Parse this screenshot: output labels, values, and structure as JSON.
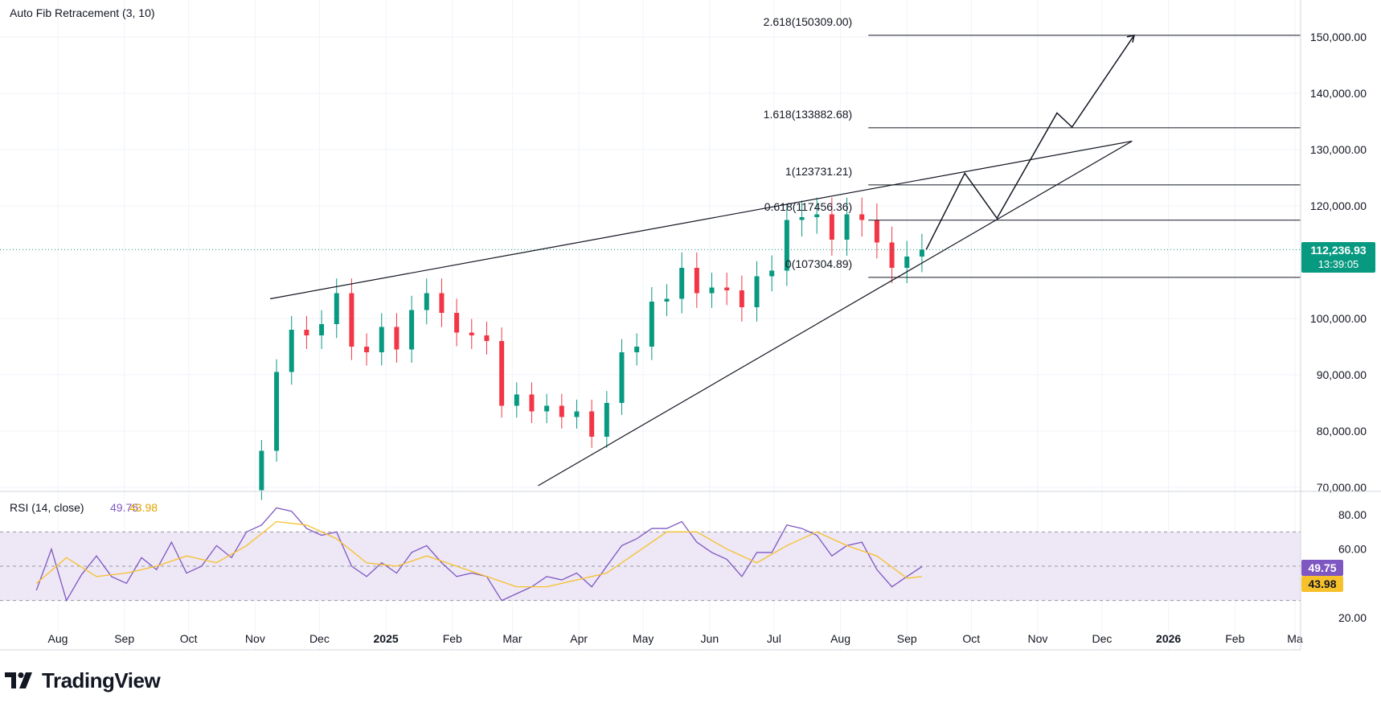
{
  "brand": {
    "name": "TradingView",
    "icon": "tradingview-logo"
  },
  "colors": {
    "bull": "#089981",
    "bear": "#F23645",
    "rsi": "#7E57C2",
    "rsi_ma": "#F7C12B",
    "rsi_band": "#EDE7F6",
    "price_badge": "#089981",
    "grid": "#F0F3FA",
    "lines": "#131722"
  },
  "chart_data": [
    {
      "type": "candlestick",
      "title": "Auto Fib Retracement (3, 10)",
      "ylim": [
        68000,
        155000
      ],
      "y_ticks": [
        "150,000.00",
        "140,000.00",
        "130,000.00",
        "120,000.00",
        "100,000.00",
        "90,000.00",
        "80,000.00",
        "70,000.00"
      ],
      "y_tick_values": [
        150000,
        140000,
        130000,
        120000,
        100000,
        90000,
        80000,
        70000
      ],
      "x_ticks": [
        "Aug",
        "Sep",
        "Oct",
        "Nov",
        "Dec",
        "2025",
        "Feb",
        "Mar",
        "Apr",
        "May",
        "Jun",
        "Jul",
        "Aug",
        "Sep",
        "Oct",
        "Nov",
        "Dec",
        "2026",
        "Feb",
        "Ma"
      ],
      "x_tick_dates": [
        "2024-08-01",
        "2024-09-01",
        "2024-10-01",
        "2024-11-01",
        "2024-12-01",
        "2025-01-01",
        "2025-02-01",
        "2025-03-01",
        "2025-04-01",
        "2025-05-01",
        "2025-06-01",
        "2025-07-01",
        "2025-08-01",
        "2025-09-01",
        "2025-10-01",
        "2025-11-01",
        "2025-12-01",
        "2026-01-01",
        "2026-02-01",
        "2026-03-01"
      ],
      "last_price": {
        "label": "112,236.93",
        "value": 112236.93,
        "countdown": "13:39:05"
      },
      "closes_weekly": [
        {
          "date": "2024-10-28",
          "close": 69500
        },
        {
          "date": "2024-11-04",
          "close": 76500
        },
        {
          "date": "2024-11-11",
          "close": 90500
        },
        {
          "date": "2024-11-18",
          "close": 98000
        },
        {
          "date": "2024-11-25",
          "close": 97000
        },
        {
          "date": "2024-12-02",
          "close": 99000
        },
        {
          "date": "2024-12-09",
          "close": 104500
        },
        {
          "date": "2024-12-16",
          "close": 95000
        },
        {
          "date": "2024-12-23",
          "close": 94000
        },
        {
          "date": "2024-12-30",
          "close": 98500
        },
        {
          "date": "2025-01-06",
          "close": 94500
        },
        {
          "date": "2025-01-13",
          "close": 101500
        },
        {
          "date": "2025-01-20",
          "close": 104500
        },
        {
          "date": "2025-01-27",
          "close": 101000
        },
        {
          "date": "2025-02-03",
          "close": 97500
        },
        {
          "date": "2025-02-10",
          "close": 97000
        },
        {
          "date": "2025-02-17",
          "close": 96000
        },
        {
          "date": "2025-02-24",
          "close": 84500
        },
        {
          "date": "2025-03-03",
          "close": 86500
        },
        {
          "date": "2025-03-10",
          "close": 83500
        },
        {
          "date": "2025-03-17",
          "close": 84500
        },
        {
          "date": "2025-03-24",
          "close": 82500
        },
        {
          "date": "2025-03-31",
          "close": 83500
        },
        {
          "date": "2025-04-07",
          "close": 79000
        },
        {
          "date": "2025-04-14",
          "close": 85000
        },
        {
          "date": "2025-04-21",
          "close": 94000
        },
        {
          "date": "2025-04-28",
          "close": 95000
        },
        {
          "date": "2025-05-05",
          "close": 103000
        },
        {
          "date": "2025-05-12",
          "close": 103500
        },
        {
          "date": "2025-05-19",
          "close": 109000
        },
        {
          "date": "2025-05-26",
          "close": 104500
        },
        {
          "date": "2025-06-02",
          "close": 105500
        },
        {
          "date": "2025-06-09",
          "close": 105000
        },
        {
          "date": "2025-06-16",
          "close": 102000
        },
        {
          "date": "2025-06-23",
          "close": 107500
        },
        {
          "date": "2025-06-30",
          "close": 108500
        },
        {
          "date": "2025-07-07",
          "close": 117500
        },
        {
          "date": "2025-07-14",
          "close": 118000
        },
        {
          "date": "2025-07-21",
          "close": 118500
        },
        {
          "date": "2025-07-28",
          "close": 114000
        },
        {
          "date": "2025-08-04",
          "close": 118500
        },
        {
          "date": "2025-08-11",
          "close": 117500
        },
        {
          "date": "2025-08-18",
          "close": 113500
        },
        {
          "date": "2025-08-25",
          "close": 109000
        },
        {
          "date": "2025-09-01",
          "close": 111000
        },
        {
          "date": "2025-09-08",
          "close": 112236.93
        }
      ],
      "fib_levels": [
        {
          "label": "2.618(150309.00)",
          "value": 150309.0
        },
        {
          "label": "1.618(133882.68)",
          "value": 133882.68
        },
        {
          "label": "1(123731.21)",
          "value": 123731.21
        },
        {
          "label": "0.618(117456.36)",
          "value": 117456.36
        },
        {
          "label": "0(107304.89)",
          "value": 107304.89
        }
      ],
      "fib_start_date": "2025-08-14",
      "trendlines": [
        {
          "name": "upper-trendline",
          "points": [
            {
              "date": "2024-11-08",
              "value": 103500
            },
            {
              "date": "2025-12-15",
              "value": 131500
            }
          ]
        },
        {
          "name": "lower-trendline",
          "points": [
            {
              "date": "2025-03-13",
              "value": 70300
            },
            {
              "date": "2025-12-15",
              "value": 131500
            }
          ]
        }
      ],
      "projection_path": [
        {
          "date": "2025-09-10",
          "value": 112236.93
        },
        {
          "date": "2025-09-28",
          "value": 125800
        },
        {
          "date": "2025-10-13",
          "value": 117800
        },
        {
          "date": "2025-11-10",
          "value": 136500
        },
        {
          "date": "2025-11-17",
          "value": 134000
        },
        {
          "date": "2025-12-16",
          "value": 150309
        }
      ]
    },
    {
      "type": "line",
      "title": "RSI (14, close)",
      "rsi_value": "49.75",
      "rsi_ma_value": "43.98",
      "ylim": [
        15,
        88
      ],
      "y_ticks": [
        "80.00",
        "60.00",
        "20.00"
      ],
      "y_tick_values": [
        80,
        60,
        20
      ],
      "bands": {
        "upper": 70,
        "middle": 50,
        "lower": 30
      },
      "rsi_weekly": [
        {
          "date": "2024-07-22",
          "value": 36
        },
        {
          "date": "2024-07-29",
          "value": 60
        },
        {
          "date": "2024-08-05",
          "value": 30
        },
        {
          "date": "2024-08-12",
          "value": 45
        },
        {
          "date": "2024-08-19",
          "value": 56
        },
        {
          "date": "2024-08-26",
          "value": 44
        },
        {
          "date": "2024-09-02",
          "value": 40
        },
        {
          "date": "2024-09-09",
          "value": 55
        },
        {
          "date": "2024-09-16",
          "value": 48
        },
        {
          "date": "2024-09-23",
          "value": 64
        },
        {
          "date": "2024-09-30",
          "value": 46
        },
        {
          "date": "2024-10-07",
          "value": 50
        },
        {
          "date": "2024-10-14",
          "value": 62
        },
        {
          "date": "2024-10-21",
          "value": 55
        },
        {
          "date": "2024-10-28",
          "value": 70
        },
        {
          "date": "2024-11-04",
          "value": 74
        },
        {
          "date": "2024-11-11",
          "value": 84
        },
        {
          "date": "2024-11-18",
          "value": 82
        },
        {
          "date": "2024-11-25",
          "value": 72
        },
        {
          "date": "2024-12-02",
          "value": 68
        },
        {
          "date": "2024-12-09",
          "value": 70
        },
        {
          "date": "2024-12-16",
          "value": 50
        },
        {
          "date": "2024-12-23",
          "value": 44
        },
        {
          "date": "2024-12-30",
          "value": 52
        },
        {
          "date": "2025-01-06",
          "value": 46
        },
        {
          "date": "2025-01-13",
          "value": 58
        },
        {
          "date": "2025-01-20",
          "value": 62
        },
        {
          "date": "2025-01-27",
          "value": 52
        },
        {
          "date": "2025-02-03",
          "value": 44
        },
        {
          "date": "2025-02-10",
          "value": 46
        },
        {
          "date": "2025-02-17",
          "value": 44
        },
        {
          "date": "2025-02-24",
          "value": 30
        },
        {
          "date": "2025-03-03",
          "value": 34
        },
        {
          "date": "2025-03-10",
          "value": 38
        },
        {
          "date": "2025-03-17",
          "value": 44
        },
        {
          "date": "2025-03-24",
          "value": 42
        },
        {
          "date": "2025-03-31",
          "value": 46
        },
        {
          "date": "2025-04-07",
          "value": 38
        },
        {
          "date": "2025-04-14",
          "value": 50
        },
        {
          "date": "2025-04-21",
          "value": 62
        },
        {
          "date": "2025-04-28",
          "value": 66
        },
        {
          "date": "2025-05-05",
          "value": 72
        },
        {
          "date": "2025-05-12",
          "value": 72
        },
        {
          "date": "2025-05-19",
          "value": 76
        },
        {
          "date": "2025-05-26",
          "value": 64
        },
        {
          "date": "2025-06-02",
          "value": 58
        },
        {
          "date": "2025-06-09",
          "value": 54
        },
        {
          "date": "2025-06-16",
          "value": 44
        },
        {
          "date": "2025-06-23",
          "value": 58
        },
        {
          "date": "2025-06-30",
          "value": 58
        },
        {
          "date": "2025-07-07",
          "value": 74
        },
        {
          "date": "2025-07-14",
          "value": 72
        },
        {
          "date": "2025-07-21",
          "value": 68
        },
        {
          "date": "2025-07-28",
          "value": 56
        },
        {
          "date": "2025-08-04",
          "value": 62
        },
        {
          "date": "2025-08-11",
          "value": 64
        },
        {
          "date": "2025-08-18",
          "value": 48
        },
        {
          "date": "2025-08-25",
          "value": 38
        },
        {
          "date": "2025-09-01",
          "value": 44
        },
        {
          "date": "2025-09-08",
          "value": 49.75
        }
      ],
      "rsi_ma_weekly": [
        {
          "date": "2024-07-22",
          "value": 40
        },
        {
          "date": "2024-08-05",
          "value": 55
        },
        {
          "date": "2024-08-19",
          "value": 44
        },
        {
          "date": "2024-09-02",
          "value": 46
        },
        {
          "date": "2024-09-16",
          "value": 50
        },
        {
          "date": "2024-09-30",
          "value": 56
        },
        {
          "date": "2024-10-14",
          "value": 52
        },
        {
          "date": "2024-10-28",
          "value": 62
        },
        {
          "date": "2024-11-11",
          "value": 76
        },
        {
          "date": "2024-11-25",
          "value": 74
        },
        {
          "date": "2024-12-09",
          "value": 66
        },
        {
          "date": "2024-12-23",
          "value": 52
        },
        {
          "date": "2025-01-06",
          "value": 50
        },
        {
          "date": "2025-01-20",
          "value": 56
        },
        {
          "date": "2025-02-03",
          "value": 50
        },
        {
          "date": "2025-02-17",
          "value": 44
        },
        {
          "date": "2025-03-03",
          "value": 38
        },
        {
          "date": "2025-03-17",
          "value": 38
        },
        {
          "date": "2025-03-31",
          "value": 42
        },
        {
          "date": "2025-04-14",
          "value": 46
        },
        {
          "date": "2025-04-28",
          "value": 58
        },
        {
          "date": "2025-05-12",
          "value": 70
        },
        {
          "date": "2025-05-26",
          "value": 70
        },
        {
          "date": "2025-06-09",
          "value": 60
        },
        {
          "date": "2025-06-23",
          "value": 52
        },
        {
          "date": "2025-07-07",
          "value": 62
        },
        {
          "date": "2025-07-21",
          "value": 70
        },
        {
          "date": "2025-08-04",
          "value": 62
        },
        {
          "date": "2025-08-18",
          "value": 56
        },
        {
          "date": "2025-09-01",
          "value": 43
        },
        {
          "date": "2025-09-08",
          "value": 43.98
        }
      ]
    }
  ]
}
